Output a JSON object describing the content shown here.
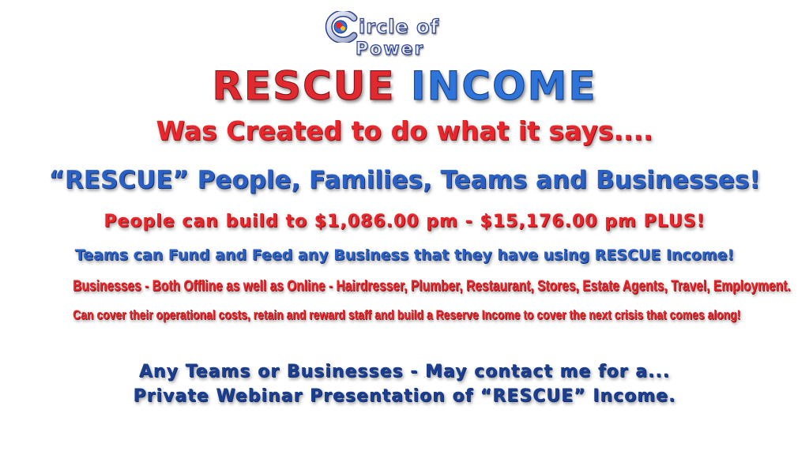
{
  "logo": {
    "line1": "ircle of",
    "line2": "Power"
  },
  "title": {
    "word1": "RESCUE",
    "word2": "INCOME"
  },
  "lines": {
    "created": "Was Created to do what it says....",
    "rescue": "“RESCUE” People, Families, Teams and Businesses!",
    "people": "People can build to $1,086.00 pm - $15,176.00 pm PLUS!",
    "teams": "Teams can Fund and Feed any Business that they have using RESCUE Income!",
    "businesses": "Businesses - Both Offline as well as Online - Hairdresser, Plumber, Restaurant, Stores, Estate Agents, Travel, Employment.",
    "cover": "Can cover their operational costs, retain and reward staff and build a Reserve Income to cover the next crisis that comes along!",
    "contact1": "Any Teams or Businesses -  May contact me for a...",
    "contact2": "Private Webinar Presentation of “RESCUE” Income."
  },
  "colors": {
    "red": "#e8262b",
    "blue": "#2a5fc4",
    "navy": "#1c3e8f",
    "background": "#ffffff"
  },
  "icons": {
    "logo": "circle-of-power-logo-icon"
  }
}
